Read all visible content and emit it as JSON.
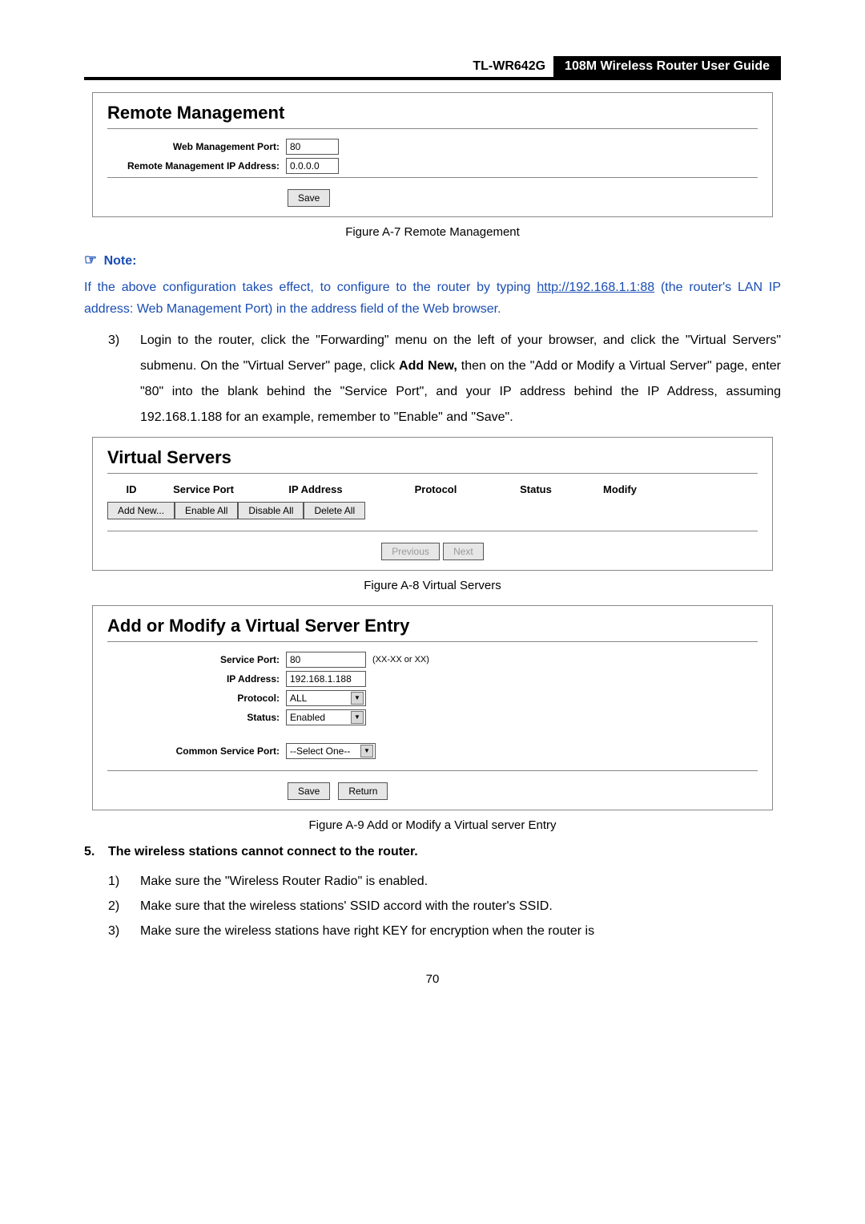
{
  "header": {
    "model": "TL-WR642G",
    "title": "108M  Wireless  Router  User  Guide"
  },
  "remote": {
    "heading": "Remote Management",
    "port_label": "Web Management Port:",
    "port_value": "80",
    "ip_label": "Remote Management IP Address:",
    "ip_value": "0.0.0.0",
    "save": "Save"
  },
  "caption_a7": "Figure A-7    Remote Management",
  "note_label": "Note:",
  "blue_para_1": "If the above configuration takes effect, to configure to the router by typing ",
  "blue_link": "http://192.168.1.1:88",
  "blue_para_2": " (the router's LAN IP address: Web Management Port) in the address field of the Web browser.",
  "step3_num": "3)",
  "step3_text_1": "Login to the router, click the \"Forwarding\" menu on the left of your browser, and click the \"Virtual Servers\" submenu. On the \"Virtual Server\" page, click ",
  "step3_bold": "Add New,",
  "step3_text_2": " then on the \"Add or Modify a Virtual Server\" page, enter \"80\" into the blank behind the \"Service Port\", and your IP address behind the IP Address, assuming 192.168.1.188 for an example, remember to \"Enable\" and \"Save\".",
  "vservers": {
    "heading": "Virtual Servers",
    "cols": {
      "id": "ID",
      "sp": "Service Port",
      "ip": "IP Address",
      "pro": "Protocol",
      "st": "Status",
      "mod": "Modify"
    },
    "btns": {
      "add": "Add New...",
      "en": "Enable All",
      "dis": "Disable All",
      "del": "Delete All"
    },
    "prev": "Previous",
    "next": "Next"
  },
  "caption_a8": "Figure A-8    Virtual Servers",
  "addmod": {
    "heading": "Add or Modify a Virtual Server Entry",
    "sp_label": "Service Port:",
    "sp_value": "80",
    "sp_hint": "(XX-XX or XX)",
    "ip_label": "IP Address:",
    "ip_value": "192.168.1.188",
    "pro_label": "Protocol:",
    "pro_value": "ALL",
    "st_label": "Status:",
    "st_value": "Enabled",
    "csp_label": "Common Service Port:",
    "csp_value": "--Select One--",
    "save": "Save",
    "return": "Return"
  },
  "caption_a9": "Figure A-9    Add or Modify a Virtual server Entry",
  "q5_num": "5.",
  "q5_text": "The wireless stations cannot connect to the router.",
  "sub": {
    "n1": "1)",
    "t1": "Make sure the \"Wireless Router Radio\" is enabled.",
    "n2": "2)",
    "t2": "Make sure that the wireless stations' SSID accord with the router's SSID.",
    "n3": "3)",
    "t3": "Make sure the wireless stations have right KEY for encryption when the router is"
  },
  "page_number": "70"
}
